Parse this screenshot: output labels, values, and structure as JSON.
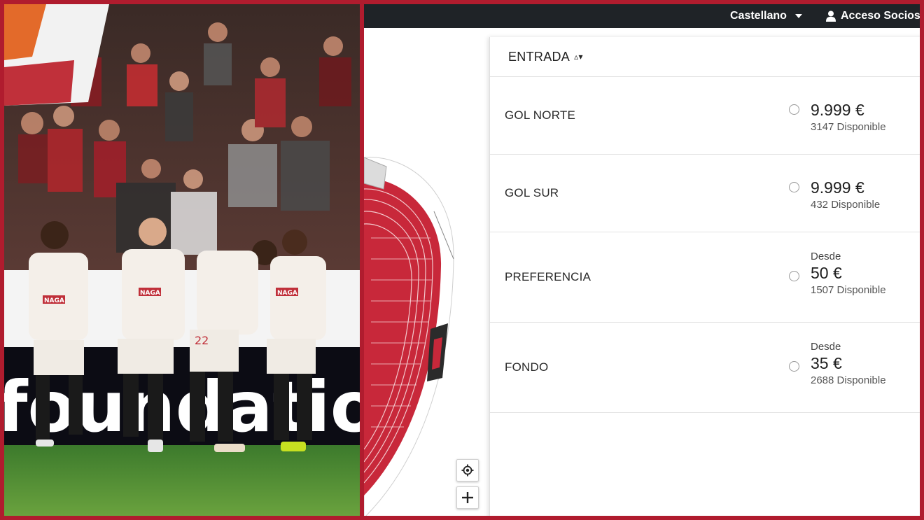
{
  "topbar": {
    "language": "Castellano",
    "member_access": "Acceso Socios"
  },
  "photo": {
    "banner_text": "foundation",
    "sponsor": "NAGA",
    "player_number": "22"
  },
  "map": {
    "locate_icon": "locate-icon",
    "zoom_in_icon": "plus-icon"
  },
  "tickets": {
    "header": "ENTRADA",
    "sort_symbol": "▵▾",
    "rows": [
      {
        "name": "GOL NORTE",
        "desde": "",
        "price": "9.999 €",
        "available": "3147 Disponible"
      },
      {
        "name": "GOL SUR",
        "desde": "",
        "price": "9.999 €",
        "available": "432 Disponible"
      },
      {
        "name": "PREFERENCIA",
        "desde": "Desde",
        "price": "50 €",
        "available": "1507 Disponible"
      },
      {
        "name": "FONDO",
        "desde": "Desde",
        "price": "35 €",
        "available": "2688 Disponible"
      }
    ]
  },
  "colors": {
    "frame": "#b01c2e",
    "topbar": "#1f2327",
    "stadium_red": "#c8283a"
  }
}
